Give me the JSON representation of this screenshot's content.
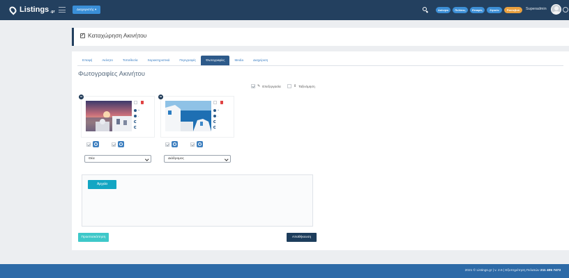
{
  "topbar": {
    "logo_text": "Listings",
    "logo_suffix": ".gr",
    "admin_dropdown": "Διαχειριστής ▾",
    "pills": [
      {
        "label": "Ακίνητα",
        "color": "#3d8fd6"
      },
      {
        "label": "Πελάτες",
        "color": "#3d8fd6"
      },
      {
        "label": "Επαφές",
        "color": "#3d8fd6"
      },
      {
        "label": "Ζητούν",
        "color": "#3d8fd6"
      },
      {
        "label": "Ραντεβού",
        "color": "#e9a03f"
      }
    ],
    "user_name": "Superadmin"
  },
  "page_header": {
    "title": "Καταχώρηση Ακινήτου"
  },
  "tabs": [
    "Επαφή",
    "Ακίνητο",
    "Τοποθεσία",
    "Χαρακτηριστικά",
    "Περιγραφές",
    "Φωτογραφίες",
    "Media",
    "Διαχείριση"
  ],
  "active_tab": "Φωτογραφίες",
  "section": {
    "title": "Φωτογραφίες Ακινήτου",
    "opt_edit": "Επεξεργασία",
    "opt_sort": "Ταξινόμηση"
  },
  "photos": [
    {
      "badge": "01",
      "category": "Θέα"
    },
    {
      "badge": "02",
      "category": "Διάδρομος"
    }
  ],
  "upload": {
    "files_button": "Αρχεία"
  },
  "buttons": {
    "preview": "Προεπισκόπηση",
    "save": "Αποθήκευση"
  },
  "footer": {
    "text_main": "2021 © Listings.gr | v. 2.6 | Εξυπηρέτηση Πελατών ",
    "phone": "211 405 7473"
  },
  "colors": {
    "navbar": "#23405f",
    "footer": "#2d6aa7",
    "active_tab": "#2d5a8a",
    "files_button": "#13a6c3",
    "preview_button": "#3ec8c9",
    "save_button": "#1d3d5c"
  }
}
